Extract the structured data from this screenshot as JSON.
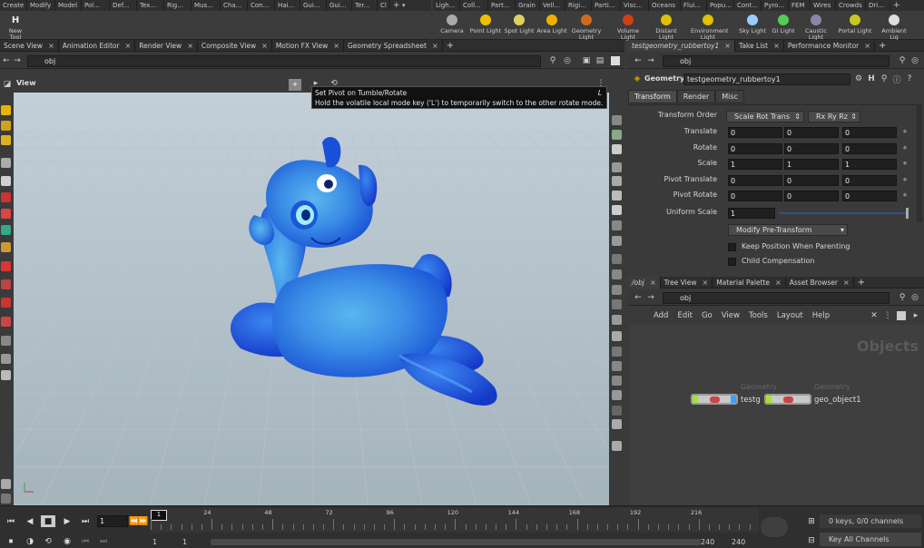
{
  "shelf_left": {
    "tabs": [
      "Create",
      "Modify",
      "Model",
      "Pol...",
      "Def...",
      "Tex...",
      "Rig...",
      "Mus...",
      "Cha...",
      "Con...",
      "Hai...",
      "Gui...",
      "Gui...",
      "Ter...",
      "Cl"
    ],
    "tool": {
      "label": "New Tool",
      "icon": "H"
    }
  },
  "shelf_right": {
    "tabs": [
      "Ligh...",
      "Coll...",
      "Part...",
      "Grain",
      "Vell...",
      "Rigi...",
      "Parti...",
      "Visc...",
      "Oceans",
      "Flui...",
      "Popu...",
      "Cont...",
      "Pyro...",
      "FEM",
      "Wires",
      "Crowds",
      "Dri..."
    ],
    "tools": [
      {
        "label": "Camera",
        "icon": "camera-icon"
      },
      {
        "label": "Point Light",
        "icon": "point-light-icon"
      },
      {
        "label": "Spot Light",
        "icon": "spot-light-icon"
      },
      {
        "label": "Area Light",
        "icon": "area-light-icon"
      },
      {
        "label": "Geometry Light",
        "icon": "geometry-light-icon"
      },
      {
        "label": "Volume Light",
        "icon": "volume-light-icon"
      },
      {
        "label": "Distant Light",
        "icon": "distant-light-icon"
      },
      {
        "label": "Environment Light",
        "icon": "environment-light-icon"
      },
      {
        "label": "Sky Light",
        "icon": "sky-light-icon"
      },
      {
        "label": "GI Light",
        "icon": "gi-light-icon"
      },
      {
        "label": "Caustic Light",
        "icon": "caustic-light-icon"
      },
      {
        "label": "Portal Light",
        "icon": "portal-light-icon"
      },
      {
        "label": "Ambient Lig",
        "icon": "ambient-light-icon"
      }
    ]
  },
  "left_panel": {
    "tabs": [
      "Scene View",
      "Animation Editor",
      "Render View",
      "Composite View",
      "Motion FX View",
      "Geometry Spreadsheet"
    ],
    "path": "obj",
    "view_label": "View"
  },
  "tooltip": {
    "title": "Set Pivot on Tumble/Rotate",
    "shortcut": "L",
    "body": "Hold the volatile local mode key ('L') to temporarily switch to the other rotate mode."
  },
  "params_panel": {
    "tabs": [
      "testgeometry_rubbertoy1",
      "Take List",
      "Performance Monitor"
    ],
    "path": "obj",
    "node_type": "Geometry",
    "node_name": "testgeometry_rubbertoy1",
    "subtabs": [
      "Transform",
      "Render",
      "Misc"
    ],
    "transform_order": {
      "label": "Transform Order",
      "value1": "Scale Rot Trans",
      "value2": "Rx Ry Rz"
    },
    "rows": [
      {
        "label": "Translate",
        "values": [
          "0",
          "0",
          "0"
        ]
      },
      {
        "label": "Rotate",
        "values": [
          "0",
          "0",
          "0"
        ]
      },
      {
        "label": "Scale",
        "values": [
          "1",
          "1",
          "1"
        ]
      },
      {
        "label": "Pivot Translate",
        "values": [
          "0",
          "0",
          "0"
        ]
      },
      {
        "label": "Pivot Rotate",
        "values": [
          "0",
          "0",
          "0"
        ]
      }
    ],
    "uniform_scale": {
      "label": "Uniform Scale",
      "value": "1"
    },
    "modify_pretransform": "Modify Pre-Transform",
    "keep_position": "Keep Position When Parenting",
    "child_compensation": "Child Compensation"
  },
  "network_panel": {
    "tabs": [
      "/obj",
      "Tree View",
      "Material Palette",
      "Asset Browser"
    ],
    "path": "obj",
    "menu": [
      "Add",
      "Edit",
      "Go",
      "View",
      "Tools",
      "Layout",
      "Help"
    ],
    "context_label": "Objects",
    "nodes": [
      {
        "type": "Geometry",
        "name": "testg"
      },
      {
        "type": "Geometry",
        "name": "geo_object1"
      }
    ]
  },
  "timeline": {
    "current_frame": "1",
    "ticks": [
      "1",
      "24",
      "48",
      "72",
      "96",
      "120",
      "144",
      "168",
      "192",
      "216"
    ],
    "start": "1",
    "start2": "1",
    "end": "240",
    "end2": "240",
    "keys_status": "0 keys, 0/0 channels",
    "key_all": "Key All Channels"
  },
  "colors": {
    "toy_blue": "#1f5fe0",
    "toy_light": "#4aa6e8",
    "accent": "#f0b400"
  }
}
